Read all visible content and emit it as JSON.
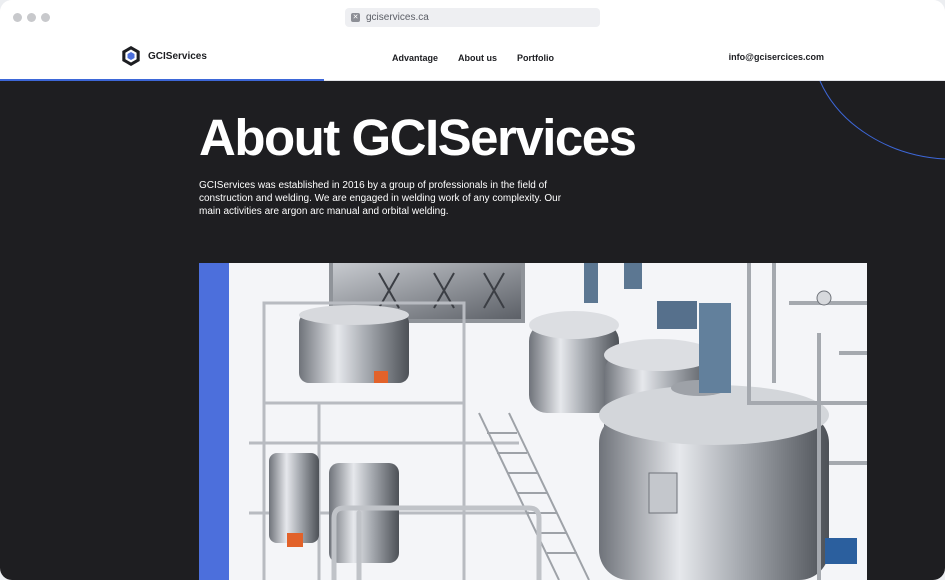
{
  "browser": {
    "url": "gciservices.ca",
    "favicon_icon": "square-x-icon"
  },
  "header": {
    "logo_text": "GCIServices",
    "nav": [
      {
        "label": "Advantage"
      },
      {
        "label": "About us"
      },
      {
        "label": "Portfolio"
      }
    ],
    "email": "info@gcisercices.com"
  },
  "hero": {
    "title": "About GCIServices",
    "description": "GCIServices was established in 2016 by a group of professionals in the field of construction and welding. We are engaged in welding work of any complexity. Our main activities are argon arc manual and orbital welding.",
    "photo_icon": "industrial-plant-photo"
  },
  "colors": {
    "accent": "#3d67d8",
    "hero_bg": "#1e1e21",
    "accent_bar": "#4c6fdc"
  }
}
